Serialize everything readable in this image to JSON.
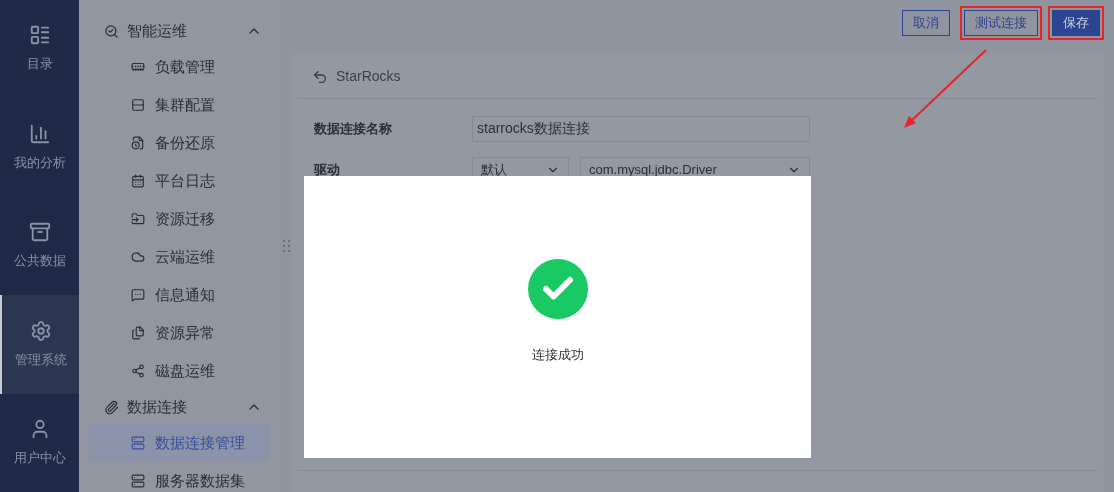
{
  "nav": [
    {
      "label": "目录",
      "selected": false
    },
    {
      "label": "我的分析",
      "selected": false
    },
    {
      "label": "公共数据",
      "selected": false
    },
    {
      "label": "管理系统",
      "selected": true
    },
    {
      "label": "用户中心",
      "selected": false
    }
  ],
  "menu": [
    {
      "label": "智能运维",
      "expanded": true,
      "children": [
        {
          "label": "负载管理",
          "selected": false
        },
        {
          "label": "集群配置",
          "selected": false
        },
        {
          "label": "备份还原",
          "selected": false
        },
        {
          "label": "平台日志",
          "selected": false
        },
        {
          "label": "资源迁移",
          "selected": false
        },
        {
          "label": "云端运维",
          "selected": false
        },
        {
          "label": "信息通知",
          "selected": false
        },
        {
          "label": "资源异常",
          "selected": false
        },
        {
          "label": "磁盘运维",
          "selected": false
        }
      ]
    },
    {
      "label": "数据连接",
      "expanded": true,
      "children": [
        {
          "label": "数据连接管理",
          "selected": true
        },
        {
          "label": "服务器数据集",
          "selected": false
        }
      ]
    }
  ],
  "toolbar": [
    {
      "label": "取消",
      "kind": "outline",
      "highlighted": false
    },
    {
      "label": "测试连接",
      "kind": "outline",
      "highlighted": true
    },
    {
      "label": "保存",
      "kind": "primary",
      "highlighted": true
    }
  ],
  "form": {
    "title": "StarRocks",
    "fields": [
      {
        "label": "数据连接名称",
        "kind": "text",
        "value": "starrocks数据连接"
      },
      {
        "label": "驱动",
        "kind": "select",
        "values": [
          "默认",
          "com.mysql.jdbc.Driver"
        ]
      }
    ]
  },
  "dialog": {
    "success": true,
    "message": "连接成功"
  }
}
